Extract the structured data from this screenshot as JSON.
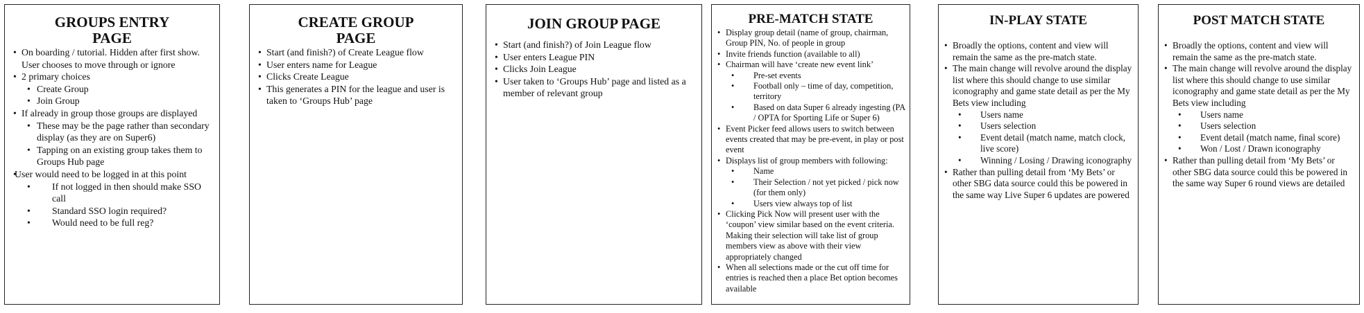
{
  "panels": [
    {
      "title": [
        "GROUPS ENTRY",
        "PAGE"
      ],
      "items": [
        {
          "level": 1,
          "text": "On boarding / tutorial.  Hidden after first show.  User chooses to move through or ignore"
        },
        {
          "level": 1,
          "text": "2 primary choices"
        },
        {
          "level": 2,
          "text": "Create Group"
        },
        {
          "level": 2,
          "text": "Join Group"
        },
        {
          "level": 1,
          "text": "If already in group those groups are displayed"
        },
        {
          "level": 2,
          "text": "These may be the page rather than secondary display (as they are on Super6)"
        },
        {
          "level": 2,
          "text": "Tapping on an existing group takes them to Groups Hub page"
        },
        {
          "level": 1,
          "text": "User  would need to be logged in at this point"
        },
        {
          "level": 2,
          "text": "If not logged in then should make SSO call"
        },
        {
          "level": 2,
          "text": "Standard SSO login required?"
        },
        {
          "level": 2,
          "text": "Would need to be full reg?"
        }
      ]
    },
    {
      "title": [
        "CREATE GROUP",
        "PAGE"
      ],
      "items": [
        {
          "level": 1,
          "text": "Start (and finish?) of Create League flow"
        },
        {
          "level": 1,
          "text": "User enters name for League"
        },
        {
          "level": 1,
          "text": "Clicks Create League"
        },
        {
          "level": 1,
          "text": "This generates a PIN for the league and user is taken to ‘Groups Hub’ page"
        }
      ]
    },
    {
      "title": [
        "JOIN GROUP PAGE"
      ],
      "items": [
        {
          "level": 1,
          "text": "Start (and finish?) of Join League flow"
        },
        {
          "level": 1,
          "text": "User enters League PIN"
        },
        {
          "level": 1,
          "text": "Clicks Join League"
        },
        {
          "level": 1,
          "text": "User taken to ‘Groups Hub’ page and listed as a member of relevant group"
        }
      ]
    },
    {
      "title": [
        "PRE-MATCH STATE"
      ],
      "items": [
        {
          "level": 1,
          "text": "Display group detail (name of group, chairman, Group PIN, No. of people in group"
        },
        {
          "level": 1,
          "text": "Invite friends function (available to all)"
        },
        {
          "level": 1,
          "text": "Chairman will have ‘create new event link’"
        },
        {
          "level": 2,
          "text": "Pre-set events"
        },
        {
          "level": 2,
          "text": "Football only – time of day, competition, territory"
        },
        {
          "level": 2,
          "text": "Based on data Super 6 already ingesting (PA / OPTA for Sporting Life or Super 6)"
        },
        {
          "level": 1,
          "text": "Event Picker feed allows users to switch between events created that may be pre-event, in play or post event"
        },
        {
          "level": 1,
          "text": "Displays list of group members with following:"
        },
        {
          "level": 2,
          "text": "Name"
        },
        {
          "level": 2,
          "text": "Their Selection / not yet picked / pick now (for them only)"
        },
        {
          "level": 2,
          "text": "Users view always top of list"
        },
        {
          "level": 1,
          "text": "Clicking Pick Now will present user with the ‘coupon’ view similar based on the event criteria.  Making their selection will take list of group members view as above with their view appropriately changed"
        },
        {
          "level": 1,
          "text": "When all selections made or the cut off time for entries is reached then a place Bet option becomes available"
        }
      ]
    },
    {
      "title": [
        "IN-PLAY STATE"
      ],
      "items": [
        {
          "level": 1,
          "text": "Broadly the options, content and view will remain the same as the pre-match state."
        },
        {
          "level": 1,
          "text": "The main change will revolve around the display list where this should change to use similar iconography and game state detail as per the My Bets view including"
        },
        {
          "level": 2,
          "text": "Users name"
        },
        {
          "level": 2,
          "text": "Users selection"
        },
        {
          "level": 2,
          "text": "Event detail (match name, match clock, live score)"
        },
        {
          "level": 2,
          "text": "Winning / Losing / Drawing iconography"
        },
        {
          "level": 1,
          "text": "Rather than pulling detail from ‘My Bets’ or other SBG data source could this be powered in the same way Live Super 6 updates are powered"
        }
      ]
    },
    {
      "title": [
        "POST MATCH STATE"
      ],
      "items": [
        {
          "level": 1,
          "text": "Broadly the options, content and view will remain the same as the pre-match state."
        },
        {
          "level": 1,
          "text": "The main change will revolve around the display list where this should change to use similar iconography and game state detail as per the My Bets view including"
        },
        {
          "level": 2,
          "text": "Users name"
        },
        {
          "level": 2,
          "text": "Users selection"
        },
        {
          "level": 2,
          "text": "Event detail (match name, final score)"
        },
        {
          "level": 2,
          "text": "Won / Lost / Drawn iconography"
        },
        {
          "level": 1,
          "text": "Rather than pulling detail from ‘My Bets’ or other SBG data source could this be powered in the same way Super 6 round views are detailed"
        }
      ]
    }
  ]
}
